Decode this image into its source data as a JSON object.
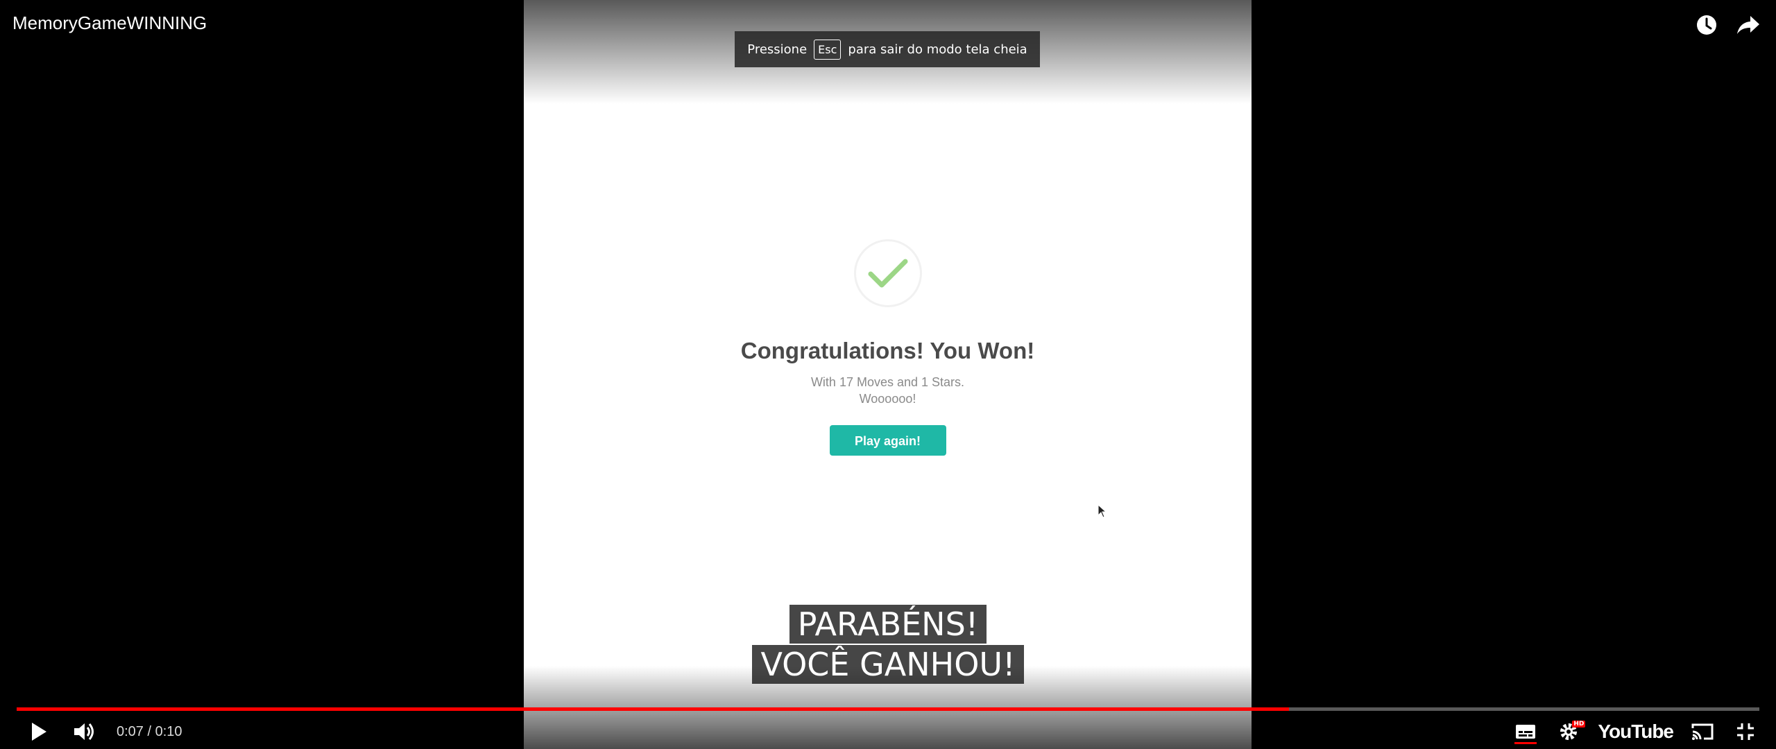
{
  "window": {
    "title": "MemoryGameWINNING"
  },
  "fullscreen_notice": {
    "prefix": "Pressione",
    "key": "Esc",
    "suffix": "para sair do modo tela cheia"
  },
  "game": {
    "title": "Congratulations! You Won!",
    "stats_line": "With 17 Moves and 1 Stars.",
    "cheer_line": "Woooooo!",
    "play_again_label": "Play again!",
    "accent_color": "#1fb8a6",
    "check_color": "#9cd686"
  },
  "captions": {
    "line1": "PARABÉNS!",
    "line2": "VOCÊ GANHOU!"
  },
  "player": {
    "current_time": "0:07",
    "duration": "0:10",
    "time_display": "0:07 / 0:10",
    "progress_fraction": 0.73,
    "progress_color": "#ff0000",
    "logo": "YouTube",
    "hd_badge": "HD"
  },
  "icons": {
    "top_right": [
      "watch-later-icon",
      "share-icon"
    ],
    "controls_left": [
      "play-icon",
      "volume-icon"
    ],
    "controls_right": [
      "subtitles-icon",
      "settings-icon",
      "youtube-logo",
      "cast-icon",
      "exit-fullscreen-icon"
    ]
  }
}
